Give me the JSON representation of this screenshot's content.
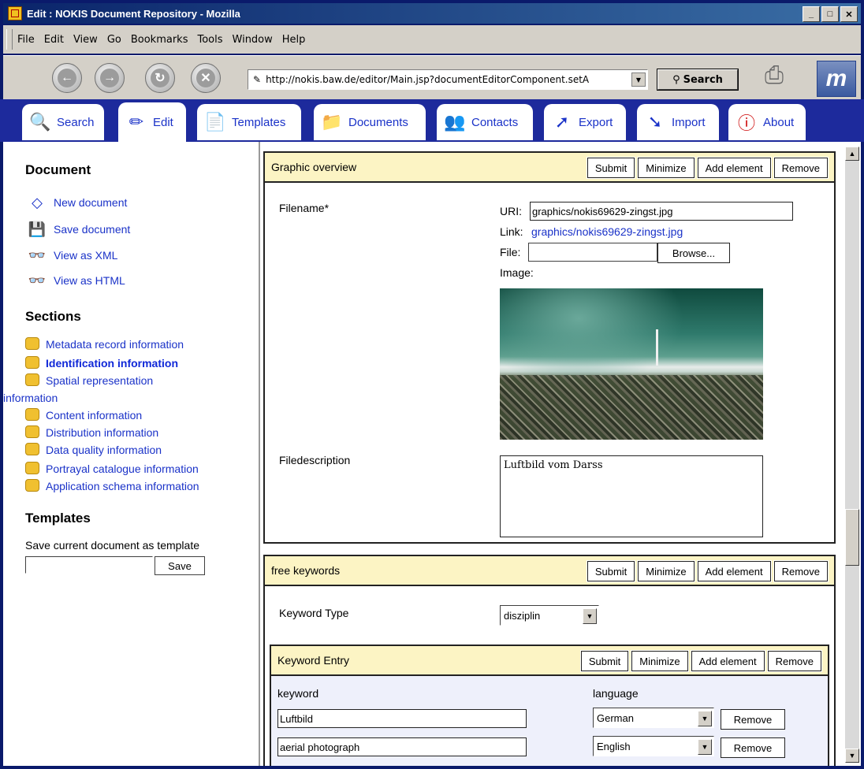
{
  "window": {
    "title": "Edit : NOKIS Document Repository - Mozilla",
    "min": "_",
    "max": "□",
    "close": "✕"
  },
  "menu": [
    "File",
    "Edit",
    "View",
    "Go",
    "Bookmarks",
    "Tools",
    "Window",
    "Help"
  ],
  "nav": {
    "url": "http://nokis.baw.de/editor/Main.jsp?documentEditorComponent.setA",
    "search_label": "Search"
  },
  "tabs": [
    {
      "label": "Search",
      "icon": "magnifier-icon"
    },
    {
      "label": "Edit",
      "icon": "pencil-icon"
    },
    {
      "label": "Templates",
      "icon": "template-icon"
    },
    {
      "label": "Documents",
      "icon": "folder-icon"
    },
    {
      "label": "Contacts",
      "icon": "contacts-icon"
    },
    {
      "label": "Export",
      "icon": "export-icon"
    },
    {
      "label": "Import",
      "icon": "import-icon"
    },
    {
      "label": "About",
      "icon": "info-icon"
    }
  ],
  "sidebar": {
    "document_heading": "Document",
    "document_links": [
      "New document",
      "Save document",
      "View as XML",
      "View as HTML"
    ],
    "sections_heading": "Sections",
    "sections": [
      "Metadata record information",
      "Identification information",
      "Spatial representation",
      "information",
      "Content information",
      "Distribution information",
      "Data quality information",
      "Portrayal catalogue information",
      "Application schema information"
    ],
    "templates_heading": "Templates",
    "templates_text": "Save current document as template",
    "save_label": "Save"
  },
  "buttons": {
    "submit": "Submit",
    "minimize": "Minimize",
    "add": "Add element",
    "remove": "Remove"
  },
  "graphic": {
    "title": "Graphic overview",
    "filename_label": "Filename*",
    "uri_label": "URI:",
    "uri_value": "graphics/nokis69629-zingst.jpg",
    "link_label": "Link:",
    "link_value": "graphics/nokis69629-zingst.jpg",
    "file_label": "File:",
    "browse_label": "Browse...",
    "image_label": "Image:",
    "filedesc_label": "Filedescription",
    "filedesc_value": "Luftbild vom Darss"
  },
  "keywords": {
    "title": "free keywords",
    "type_label": "Keyword Type",
    "type_value": "disziplin",
    "entry_title": "Keyword Entry",
    "keyword_col": "keyword",
    "language_col": "language",
    "rows": [
      {
        "keyword": "Luftbild",
        "language": "German"
      },
      {
        "keyword": "aerial photograph",
        "language": "English"
      }
    ]
  }
}
